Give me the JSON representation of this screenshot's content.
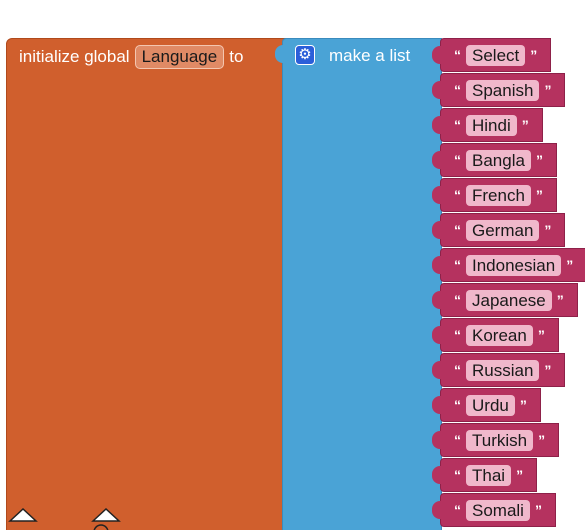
{
  "init": {
    "prefix": "initialize global",
    "variable": "Language",
    "suffix": "to"
  },
  "list": {
    "gear": "⚙",
    "label": "make a list"
  },
  "quote_open": "“",
  "quote_close": "”",
  "items": [
    {
      "value": "Select"
    },
    {
      "value": "Spanish"
    },
    {
      "value": "Hindi"
    },
    {
      "value": "Bangla"
    },
    {
      "value": "French"
    },
    {
      "value": "German"
    },
    {
      "value": "Indonesian"
    },
    {
      "value": "Japanese"
    },
    {
      "value": "Korean"
    },
    {
      "value": "Russian"
    },
    {
      "value": "Urdu"
    },
    {
      "value": "Turkish"
    },
    {
      "value": "Thai"
    },
    {
      "value": "Somali"
    }
  ],
  "colors": {
    "init_block": "#d05f2d",
    "list_block": "#4aa3d6",
    "text_block": "#b5325f"
  }
}
